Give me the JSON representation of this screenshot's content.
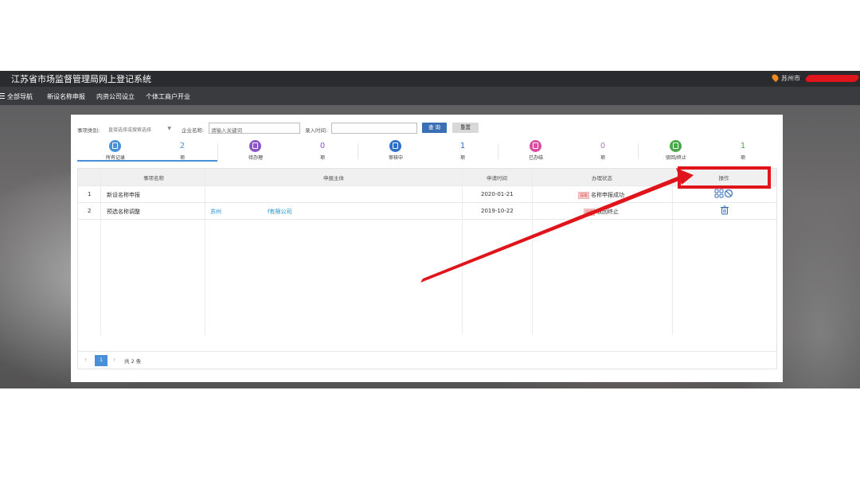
{
  "header": {
    "title": "江苏省市场监督管理局网上登记系统",
    "location": "苏州市"
  },
  "nav": {
    "items": [
      "全部导航",
      "新设名称申报",
      "内资公司设立",
      "个体工商户开业"
    ]
  },
  "filters": {
    "type_label": "事项类别:",
    "type_value": "直接选择或搜索选择",
    "company_label": "企业名称:",
    "company_placeholder": "请输入关键词",
    "time_label": "录入时间:",
    "query_button": "查 询",
    "reset_button": "重置"
  },
  "stats": [
    {
      "name": "所有记录",
      "count": "2",
      "unit": "项",
      "color": "#4a90d9"
    },
    {
      "name": "待办理",
      "count": "0",
      "unit": "项",
      "color": "#8a56c8"
    },
    {
      "name": "审核中",
      "count": "1",
      "unit": "项",
      "color": "#2f6fc9"
    },
    {
      "name": "已办结",
      "count": "0",
      "unit": "项",
      "color": "#d94fa3"
    },
    {
      "name": "驳回/终止",
      "count": "1",
      "unit": "项",
      "color": "#4aa84a"
    }
  ],
  "table": {
    "headers": [
      "事项名称",
      "申报主体",
      "申请时间",
      "办理状态",
      "操作"
    ],
    "rows": [
      {
        "num": "1",
        "name": "新设名称申报",
        "subject_a": "",
        "subject_b": "",
        "date": "2020-01-21",
        "tag": "提醒",
        "status": "名称申报成功"
      },
      {
        "num": "2",
        "name": "预选名称调整",
        "subject_a": "苏州",
        "subject_b": "f有限公司",
        "date": "2019-10-22",
        "tag": "提醒",
        "status": "驳回终止"
      }
    ]
  },
  "pager": {
    "current": "1",
    "total": "共 2 条"
  }
}
